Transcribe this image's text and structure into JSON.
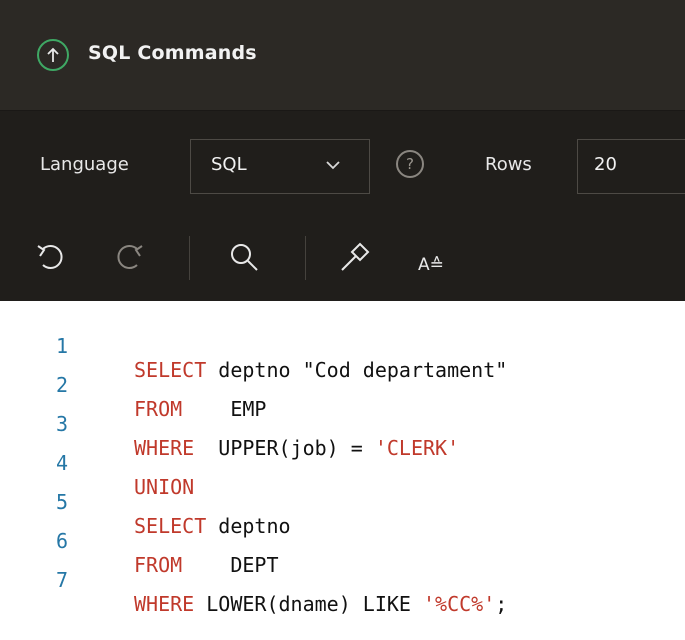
{
  "header": {
    "title": "SQL Commands",
    "collapse_icon": "arrow-up-circle-icon"
  },
  "options": {
    "language_label": "Language",
    "language_value": "SQL",
    "rows_label": "Rows",
    "rows_value": "20",
    "help_icon_text": "?"
  },
  "toolbar": {
    "undo_icon": "undo-icon",
    "redo_icon": "redo-icon",
    "find_icon": "search-icon",
    "autocomplete_icon": "hammer-icon",
    "format_label": "A≙"
  },
  "editor": {
    "lines": [
      {
        "n": "1",
        "kw": "SELECT",
        "rest": " deptno \"Cod departament\""
      },
      {
        "n": "2",
        "kw": "FROM",
        "rest": "    EMP"
      },
      {
        "n": "3",
        "kw": "WHERE",
        "rest": "  UPPER(job) = 'CLERK'"
      },
      {
        "n": "4",
        "kw": "UNION",
        "rest": ""
      },
      {
        "n": "5",
        "kw": "SELECT",
        "rest": " deptno"
      },
      {
        "n": "6",
        "kw": "FROM",
        "rest": "    DEPT"
      },
      {
        "n": "7",
        "kw": "WHERE",
        "rest": " LOWER(dname) LIKE '%CC%';"
      }
    ]
  },
  "colors": {
    "header_bg": "#2c2925",
    "toolbar_bg": "#201e1b",
    "accent_green": "#3fa864",
    "keyword_red": "#c0392b",
    "line_number_blue": "#2577a6"
  }
}
